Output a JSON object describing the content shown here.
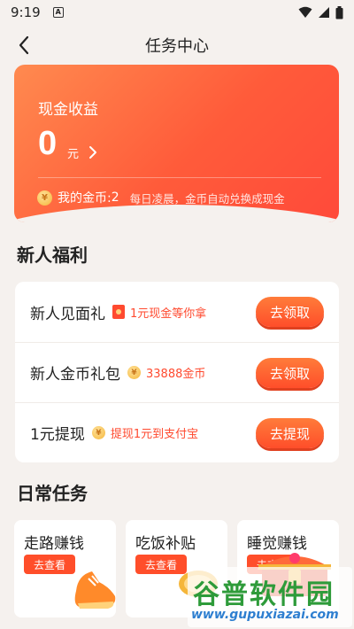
{
  "status_bar": {
    "time": "9:19",
    "a_icon": "A"
  },
  "nav": {
    "title": "任务中心"
  },
  "earnings": {
    "label": "现金收益",
    "amount": "0",
    "unit": "元",
    "coins_label": "我的金币:",
    "coins_value": "2",
    "coins_note": "每日凌晨，金币自动兑换成现金"
  },
  "newbie": {
    "title": "新人福利",
    "items": [
      {
        "name": "新人见面礼",
        "icon": "red-envelope-icon",
        "tag": "1元现金等你拿",
        "button": "去领取"
      },
      {
        "name": "新人金币礼包",
        "icon": "coin-icon",
        "tag": "33888金币",
        "button": "去领取"
      },
      {
        "name": "1元提现",
        "icon": "coin-icon",
        "tag": "提现1元到支付宝",
        "button": "去提现"
      }
    ]
  },
  "daily": {
    "title": "日常任务",
    "items": [
      {
        "name": "走路赚钱",
        "button": "去查看"
      },
      {
        "name": "吃饭补贴",
        "button": "去查看"
      },
      {
        "name": "睡觉赚钱",
        "button": "去查看"
      }
    ]
  },
  "watermark": {
    "cn": "谷普软件园",
    "url": "www.gupuxiazai.com"
  },
  "colors": {
    "accent": "#ff4e2a",
    "coin": "#f5b63a",
    "background": "#f5f1ee"
  }
}
